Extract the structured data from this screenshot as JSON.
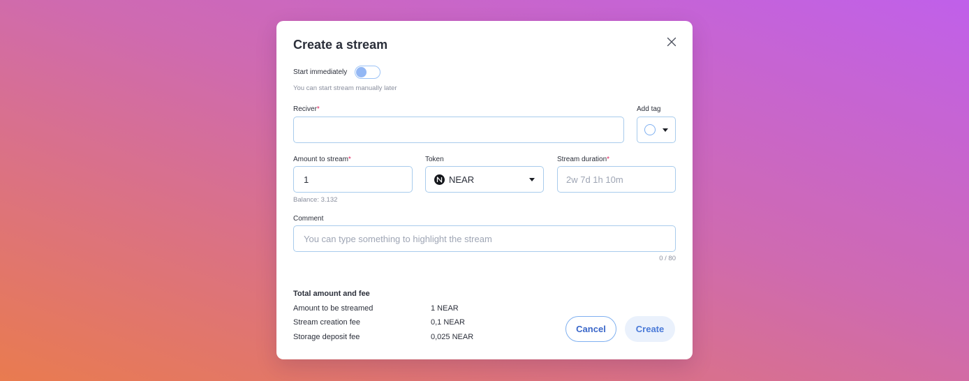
{
  "modal": {
    "title": "Create a stream",
    "start": {
      "label": "Start immediately",
      "hint": "You can start stream manually later",
      "enabled": false
    },
    "receiver": {
      "label": "Reciver",
      "required_mark": "*",
      "value": ""
    },
    "tag": {
      "label": "Add tag"
    },
    "amount": {
      "label": "Amount to stream",
      "required_mark": "*",
      "value": "1",
      "balance": "Balance: 3.132"
    },
    "token": {
      "label": "Token",
      "value": "NEAR",
      "icon": "near-logo-icon"
    },
    "duration": {
      "label": "Stream duration",
      "required_mark": "*",
      "placeholder": "2w 7d 1h 10m"
    },
    "comment": {
      "label": "Comment",
      "placeholder": "You can type something to highlight the stream",
      "counter": "0 / 80"
    },
    "summary": {
      "title": "Total amount and fee",
      "rows": [
        {
          "label": "Amount to be streamed",
          "value": "1 NEAR"
        },
        {
          "label": "Stream creation fee",
          "value": "0,1 NEAR"
        },
        {
          "label": "Storage deposit fee",
          "value": "0,025 NEAR"
        }
      ]
    },
    "buttons": {
      "cancel": "Cancel",
      "create": "Create"
    }
  },
  "colors": {
    "accent": "#3a67c9",
    "field_border": "#a8cbec",
    "required": "#e0245e",
    "background_top": "#c060ea",
    "background_bottom": "#e97b4f"
  }
}
